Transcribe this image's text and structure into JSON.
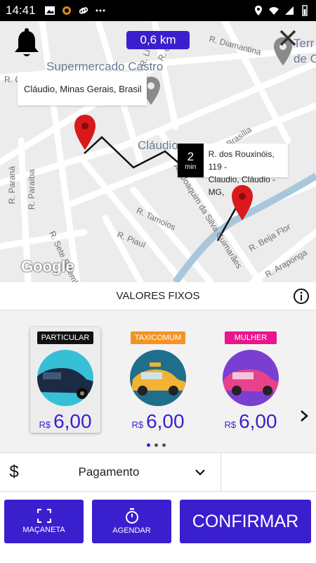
{
  "status_bar": {
    "time": "14:41"
  },
  "map": {
    "distance": "0,6 km",
    "origin_address": "Cláudio, Minas Gerais, Brasil",
    "eta_minutes": "2",
    "eta_unit": "min",
    "destination_address_line1": "R. dos Rouxinóis, 119 -",
    "destination_address_line2": "Claudio, Cláudio - MG,",
    "poi_supermarket": "Supermercado Castro",
    "city_label": "Cláudio",
    "poi_partial": "Terr",
    "poi_partial2": "de C",
    "streets": {
      "diamantina": "R. Diamantina",
      "goias": "R. Goiás",
      "brasilia": "Brasília",
      "parana": "R. Paraná",
      "paraiba": "R. Paraíba",
      "tamoios": "R. Tamoios",
      "piaui": "R. Piauí",
      "sete_setembro": "R. Sete Setemb",
      "joaquim": "Av. Joaquim da Silva Guimarães",
      "beija_flor": "R. Beija Flor",
      "araponga": "R. Araponga",
      "r_partial": "R. C",
      "li_partial": "R. Li"
    },
    "google": "Google"
  },
  "panel": {
    "header": "VALORES FIXOS",
    "cards": [
      {
        "tag": "PARTICULAR",
        "currency": "R$",
        "price": "6,00",
        "tag_color": "#111111",
        "car_color": "#1c2a44",
        "bg_color": "#36c0d8"
      },
      {
        "tag": "TAXICOMUM",
        "currency": "R$",
        "price": "6,00",
        "tag_color": "#f39322",
        "car_color": "#f2b233",
        "bg_color": "#1f6f8c"
      },
      {
        "tag": "MULHER",
        "currency": "R$",
        "price": "6,00",
        "tag_color": "#e8168c",
        "car_color": "#e8428c",
        "bg_color": "#7a3fd1"
      }
    ],
    "payment_symbol": "$",
    "payment_label": "Pagamento",
    "buttons": {
      "macaneta": "MAÇANETA",
      "agendar": "AGENDAR",
      "confirmar": "CONFIRMAR"
    }
  },
  "colors": {
    "accent": "#3a1fcf",
    "pin": "#d9191c"
  }
}
